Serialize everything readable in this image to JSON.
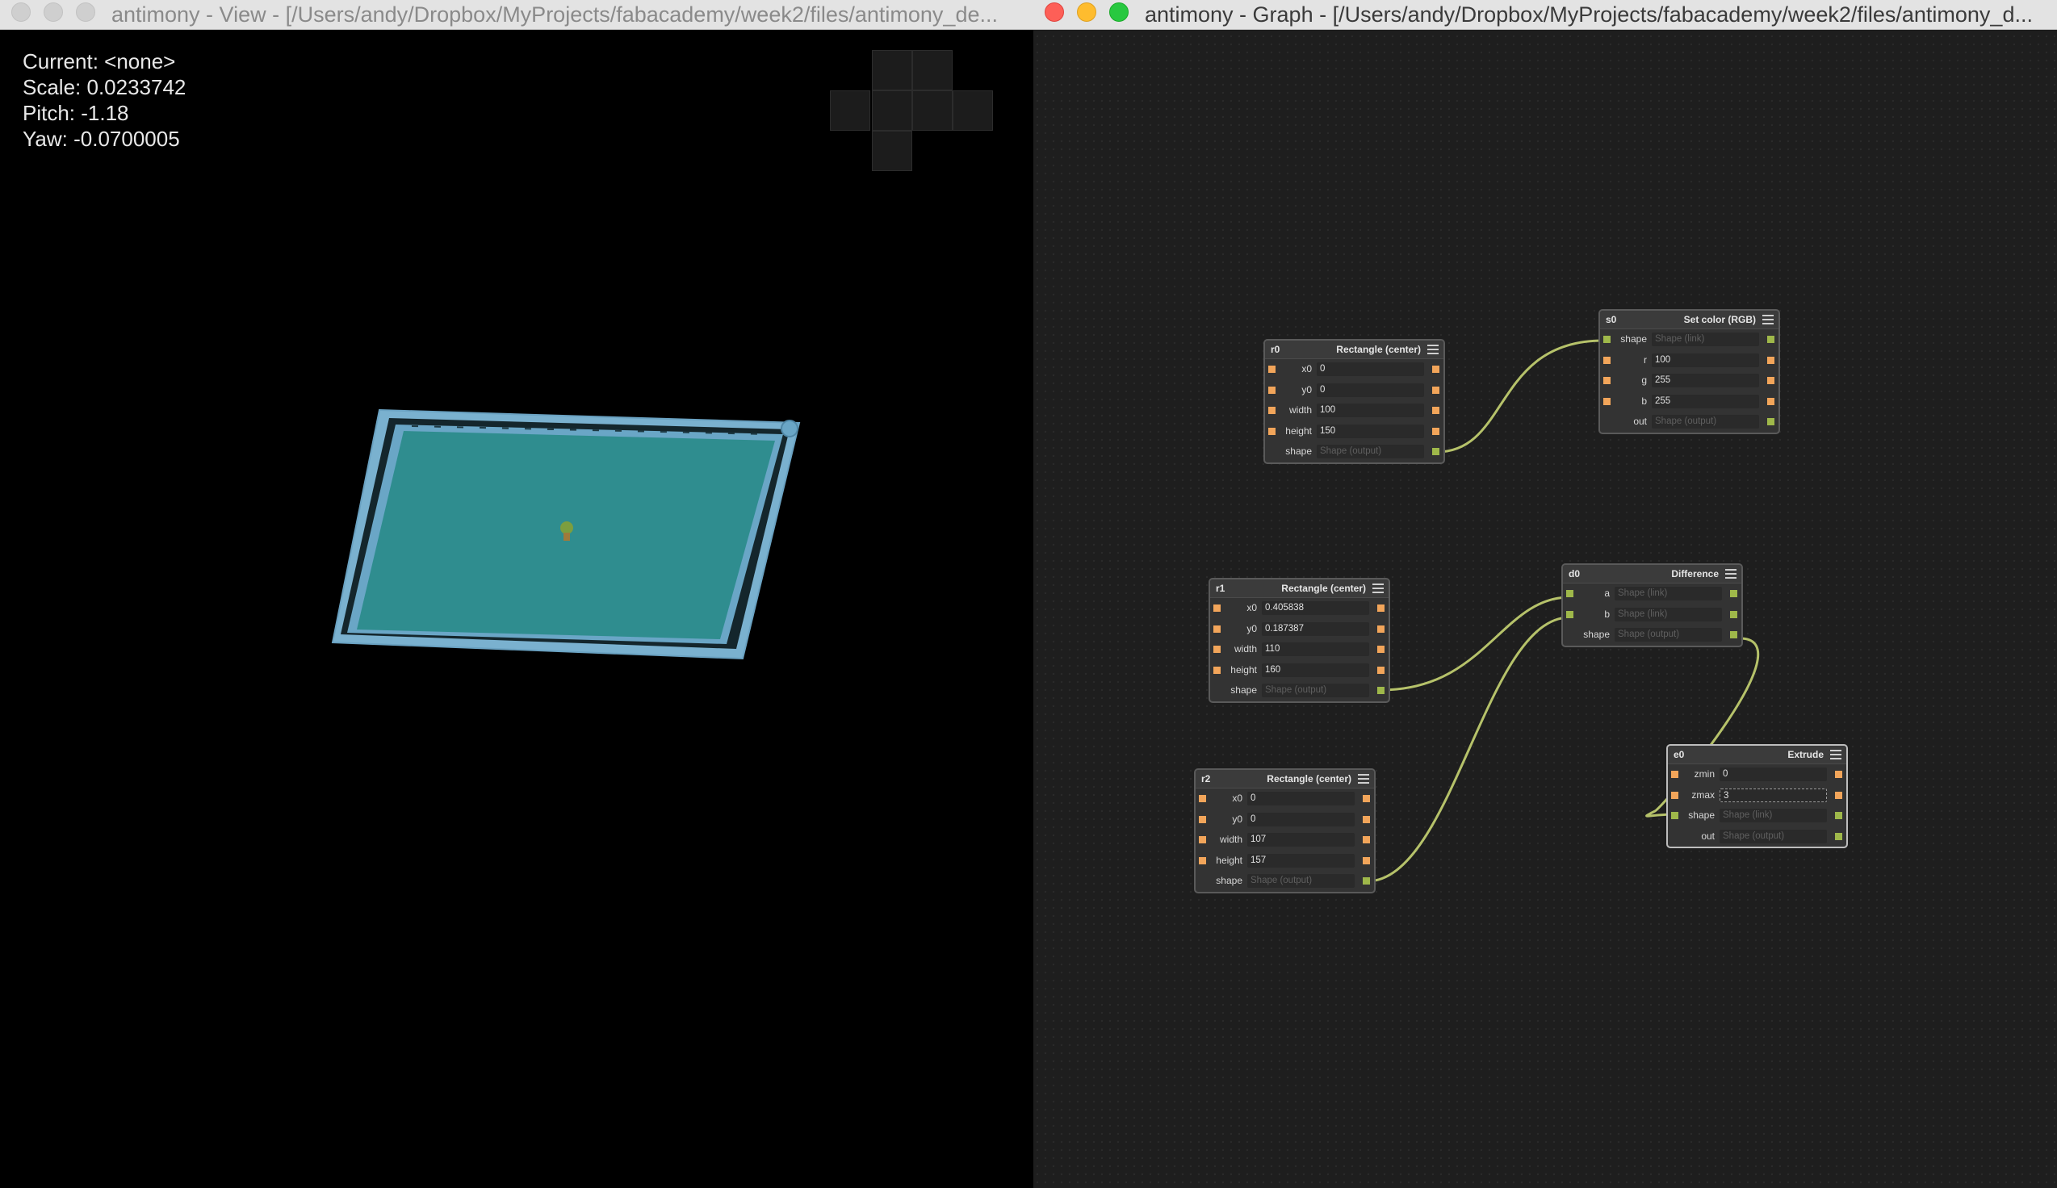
{
  "view_window": {
    "title": "antimony - View - [/Users/andy/Dropbox/MyProjects/fabacademy/week2/files/antimony_de...",
    "hud": {
      "current": "Current: <none>",
      "scale": "Scale: 0.0233742",
      "pitch": "Pitch: -1.18",
      "yaw": "Yaw: -0.0700005"
    }
  },
  "graph_window": {
    "title": "antimony - Graph - [/Users/andy/Dropbox/MyProjects/fabacademy/week2/files/antimony_d..."
  },
  "nodes": {
    "r0": {
      "id": "r0",
      "type": "Rectangle (center)",
      "rows": [
        {
          "label": "x0",
          "value": "0"
        },
        {
          "label": "y0",
          "value": "0"
        },
        {
          "label": "width",
          "value": "100"
        },
        {
          "label": "height",
          "value": "150"
        },
        {
          "label": "shape",
          "value": "Shape (output)"
        }
      ]
    },
    "s0": {
      "id": "s0",
      "type": "Set color (RGB)",
      "rows": [
        {
          "label": "shape",
          "value": "Shape (link)"
        },
        {
          "label": "r",
          "value": "100"
        },
        {
          "label": "g",
          "value": "255"
        },
        {
          "label": "b",
          "value": "255"
        },
        {
          "label": "out",
          "value": "Shape (output)"
        }
      ]
    },
    "r1": {
      "id": "r1",
      "type": "Rectangle (center)",
      "rows": [
        {
          "label": "x0",
          "value": "0.405838"
        },
        {
          "label": "y0",
          "value": "0.187387"
        },
        {
          "label": "width",
          "value": "110"
        },
        {
          "label": "height",
          "value": "160"
        },
        {
          "label": "shape",
          "value": "Shape (output)"
        }
      ]
    },
    "d0": {
      "id": "d0",
      "type": "Difference",
      "rows": [
        {
          "label": "a",
          "value": "Shape (link)"
        },
        {
          "label": "b",
          "value": "Shape (link)"
        },
        {
          "label": "shape",
          "value": "Shape (output)"
        }
      ]
    },
    "r2": {
      "id": "r2",
      "type": "Rectangle (center)",
      "rows": [
        {
          "label": "x0",
          "value": "0"
        },
        {
          "label": "y0",
          "value": "0"
        },
        {
          "label": "width",
          "value": "107"
        },
        {
          "label": "height",
          "value": "157"
        },
        {
          "label": "shape",
          "value": "Shape (output)"
        }
      ]
    },
    "e0": {
      "id": "e0",
      "type": "Extrude",
      "rows": [
        {
          "label": "zmin",
          "value": "0"
        },
        {
          "label": "zmax",
          "value": "3"
        },
        {
          "label": "shape",
          "value": "Shape (link)"
        },
        {
          "label": "out",
          "value": "Shape (output)"
        }
      ]
    }
  },
  "colors": {
    "number_port": "#f2a55a",
    "shape_port": "#9fb84a",
    "wire": "#b6c26a",
    "model_fill": "#2f8d8f",
    "model_frame": "#7ab1cf"
  }
}
